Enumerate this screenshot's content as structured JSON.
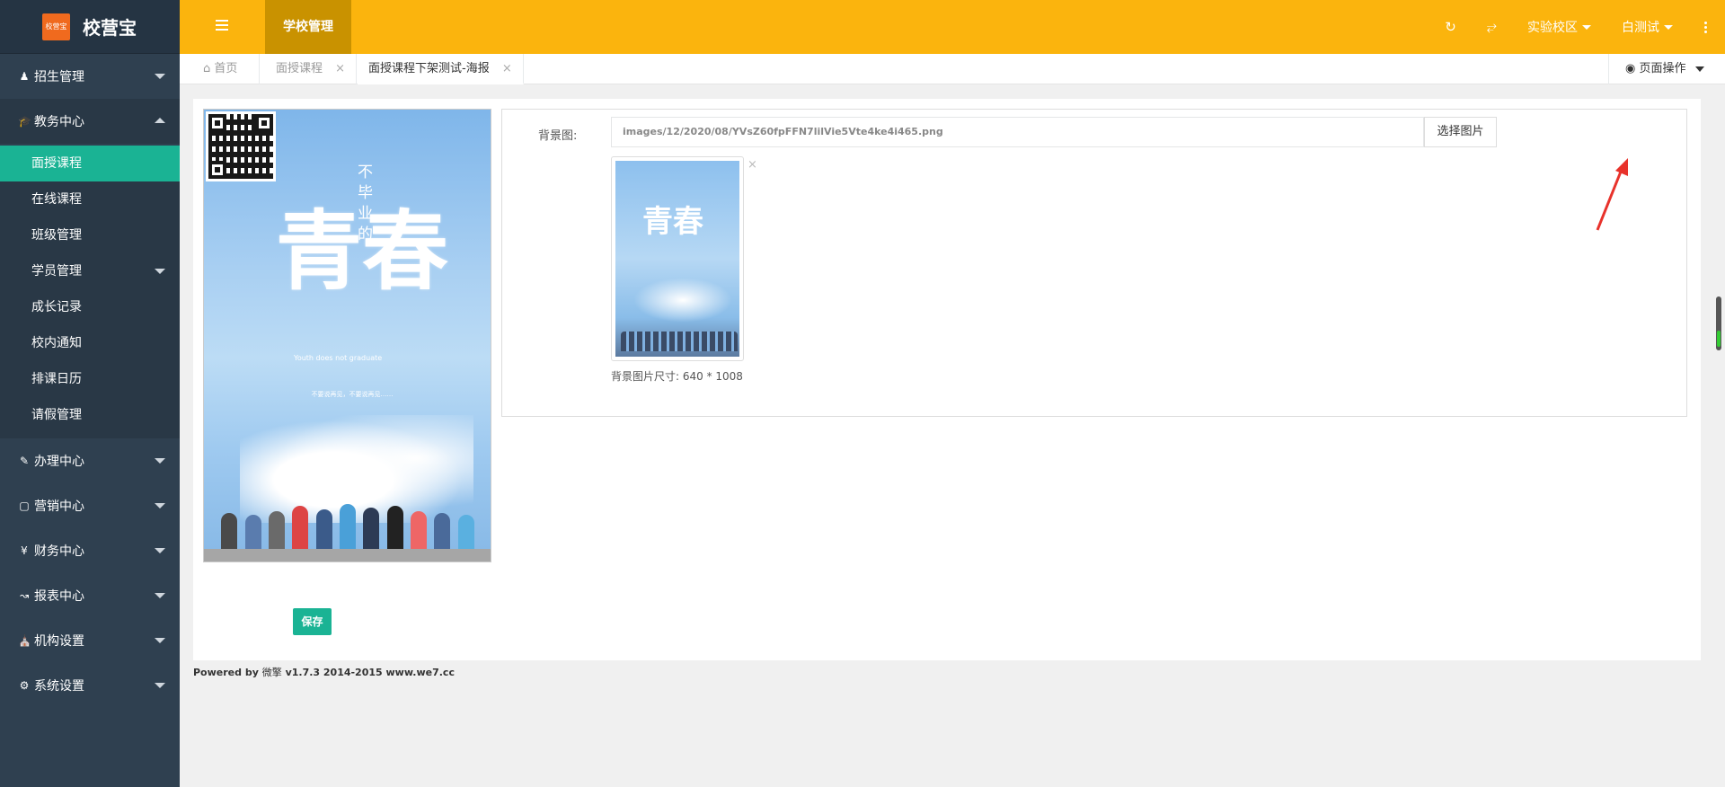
{
  "brand": {
    "logo_text": "校营宝",
    "name": "校营宝"
  },
  "sidebar": {
    "groups": [
      {
        "icon": "user-icon",
        "label": "招生管理"
      },
      {
        "icon": "graduation-cap-icon",
        "label": "教务中心"
      }
    ],
    "sub_items": [
      "面授课程",
      "在线课程",
      "班级管理",
      "学员管理",
      "成长记录",
      "校内通知",
      "排课日历",
      "请假管理"
    ],
    "bottom_groups": [
      {
        "icon": "edit-icon",
        "label": "办理中心"
      },
      {
        "icon": "laptop-icon",
        "label": "营销中心"
      },
      {
        "icon": "yen-icon",
        "label": "财务中心"
      },
      {
        "icon": "line-chart-icon",
        "label": "报表中心"
      },
      {
        "icon": "bank-icon",
        "label": "机构设置"
      },
      {
        "icon": "gears-icon",
        "label": "系统设置"
      }
    ]
  },
  "topbar": {
    "tab": "学校管理",
    "campus": "实验校区",
    "user": "白测试"
  },
  "tabs": {
    "home": "首页",
    "t1": "面授课程",
    "t2": "面授课程下架测试-海报",
    "close": "×",
    "page_ops": "页面操作"
  },
  "poster": {
    "vert": "不毕业的",
    "big": "青春",
    "sub": "Youth does not graduate",
    "para": "不要说再见，不要说再见……"
  },
  "form": {
    "bg_label": "背景图:",
    "path": "images/12/2020/08/YVsZ60fpFFN7lilVie5Vte4ke4i465.png",
    "choose": "选择图片",
    "close": "×",
    "size": "背景图片尺寸: 640 * 1008"
  },
  "save": "保存",
  "footer": {
    "powered": "Powered by",
    "we": "微擎",
    "ver": "v1.7.3 2014-2015 www.we7.cc"
  },
  "colors": {
    "topbar": "#fbb40d",
    "sidebar": "#2f4050",
    "accent": "#1ab394"
  }
}
